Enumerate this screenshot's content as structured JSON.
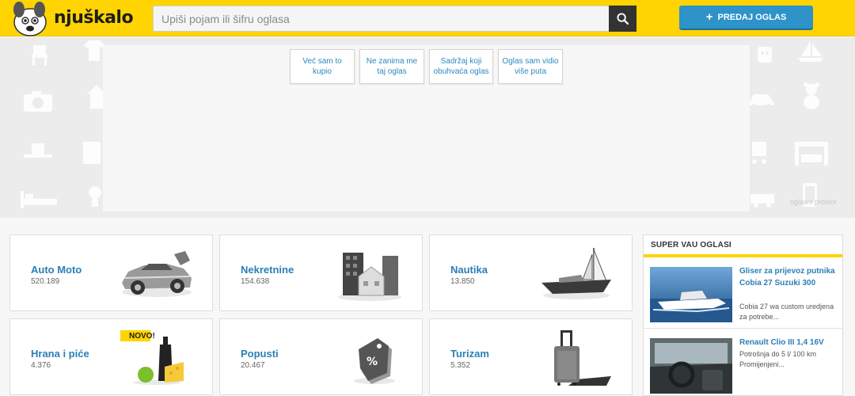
{
  "header": {
    "logo_text": "njuškalo",
    "search_placeholder": "Upiši pojam ili šifru oglasa",
    "post_button_label": "PREDAJ OGLAS"
  },
  "banner": {
    "feedback_options": [
      "Već sam to kupio",
      "Ne zanima me taj oglas",
      "Sadržaj koji obuhvaća oglas",
      "Oglas sam vidio više puta"
    ],
    "ad_label": "oglasni prostor"
  },
  "categories": [
    {
      "name": "Auto Moto",
      "count": "520.189",
      "icon": "car-icon"
    },
    {
      "name": "Nekretnine",
      "count": "154.638",
      "icon": "buildings-icon"
    },
    {
      "name": "Nautika",
      "count": "13.850",
      "icon": "boat-icon"
    },
    {
      "name": "Hrana i piće",
      "count": "4.376",
      "icon": "food-icon",
      "badge": "NOVO!"
    },
    {
      "name": "Popusti",
      "count": "20.467",
      "icon": "tag-icon"
    },
    {
      "name": "Turizam",
      "count": "5.352",
      "icon": "suitcase-icon"
    }
  ],
  "super_ads": {
    "title": "SUPER VAU OGLASI",
    "items": [
      {
        "title": "Gliser za prijevoz putnika Cobia 27 Suzuki 300",
        "desc": "Cobia 27 wa custom uredjena za potrebe..."
      },
      {
        "title": "Renault Clio III 1,4 16V",
        "desc": "Potrošnja do 5 l/ 100 km Promijenjeni..."
      }
    ]
  },
  "colors": {
    "brand": "#ffd400",
    "accent": "#2d93c8",
    "link": "#2a7fb6"
  }
}
